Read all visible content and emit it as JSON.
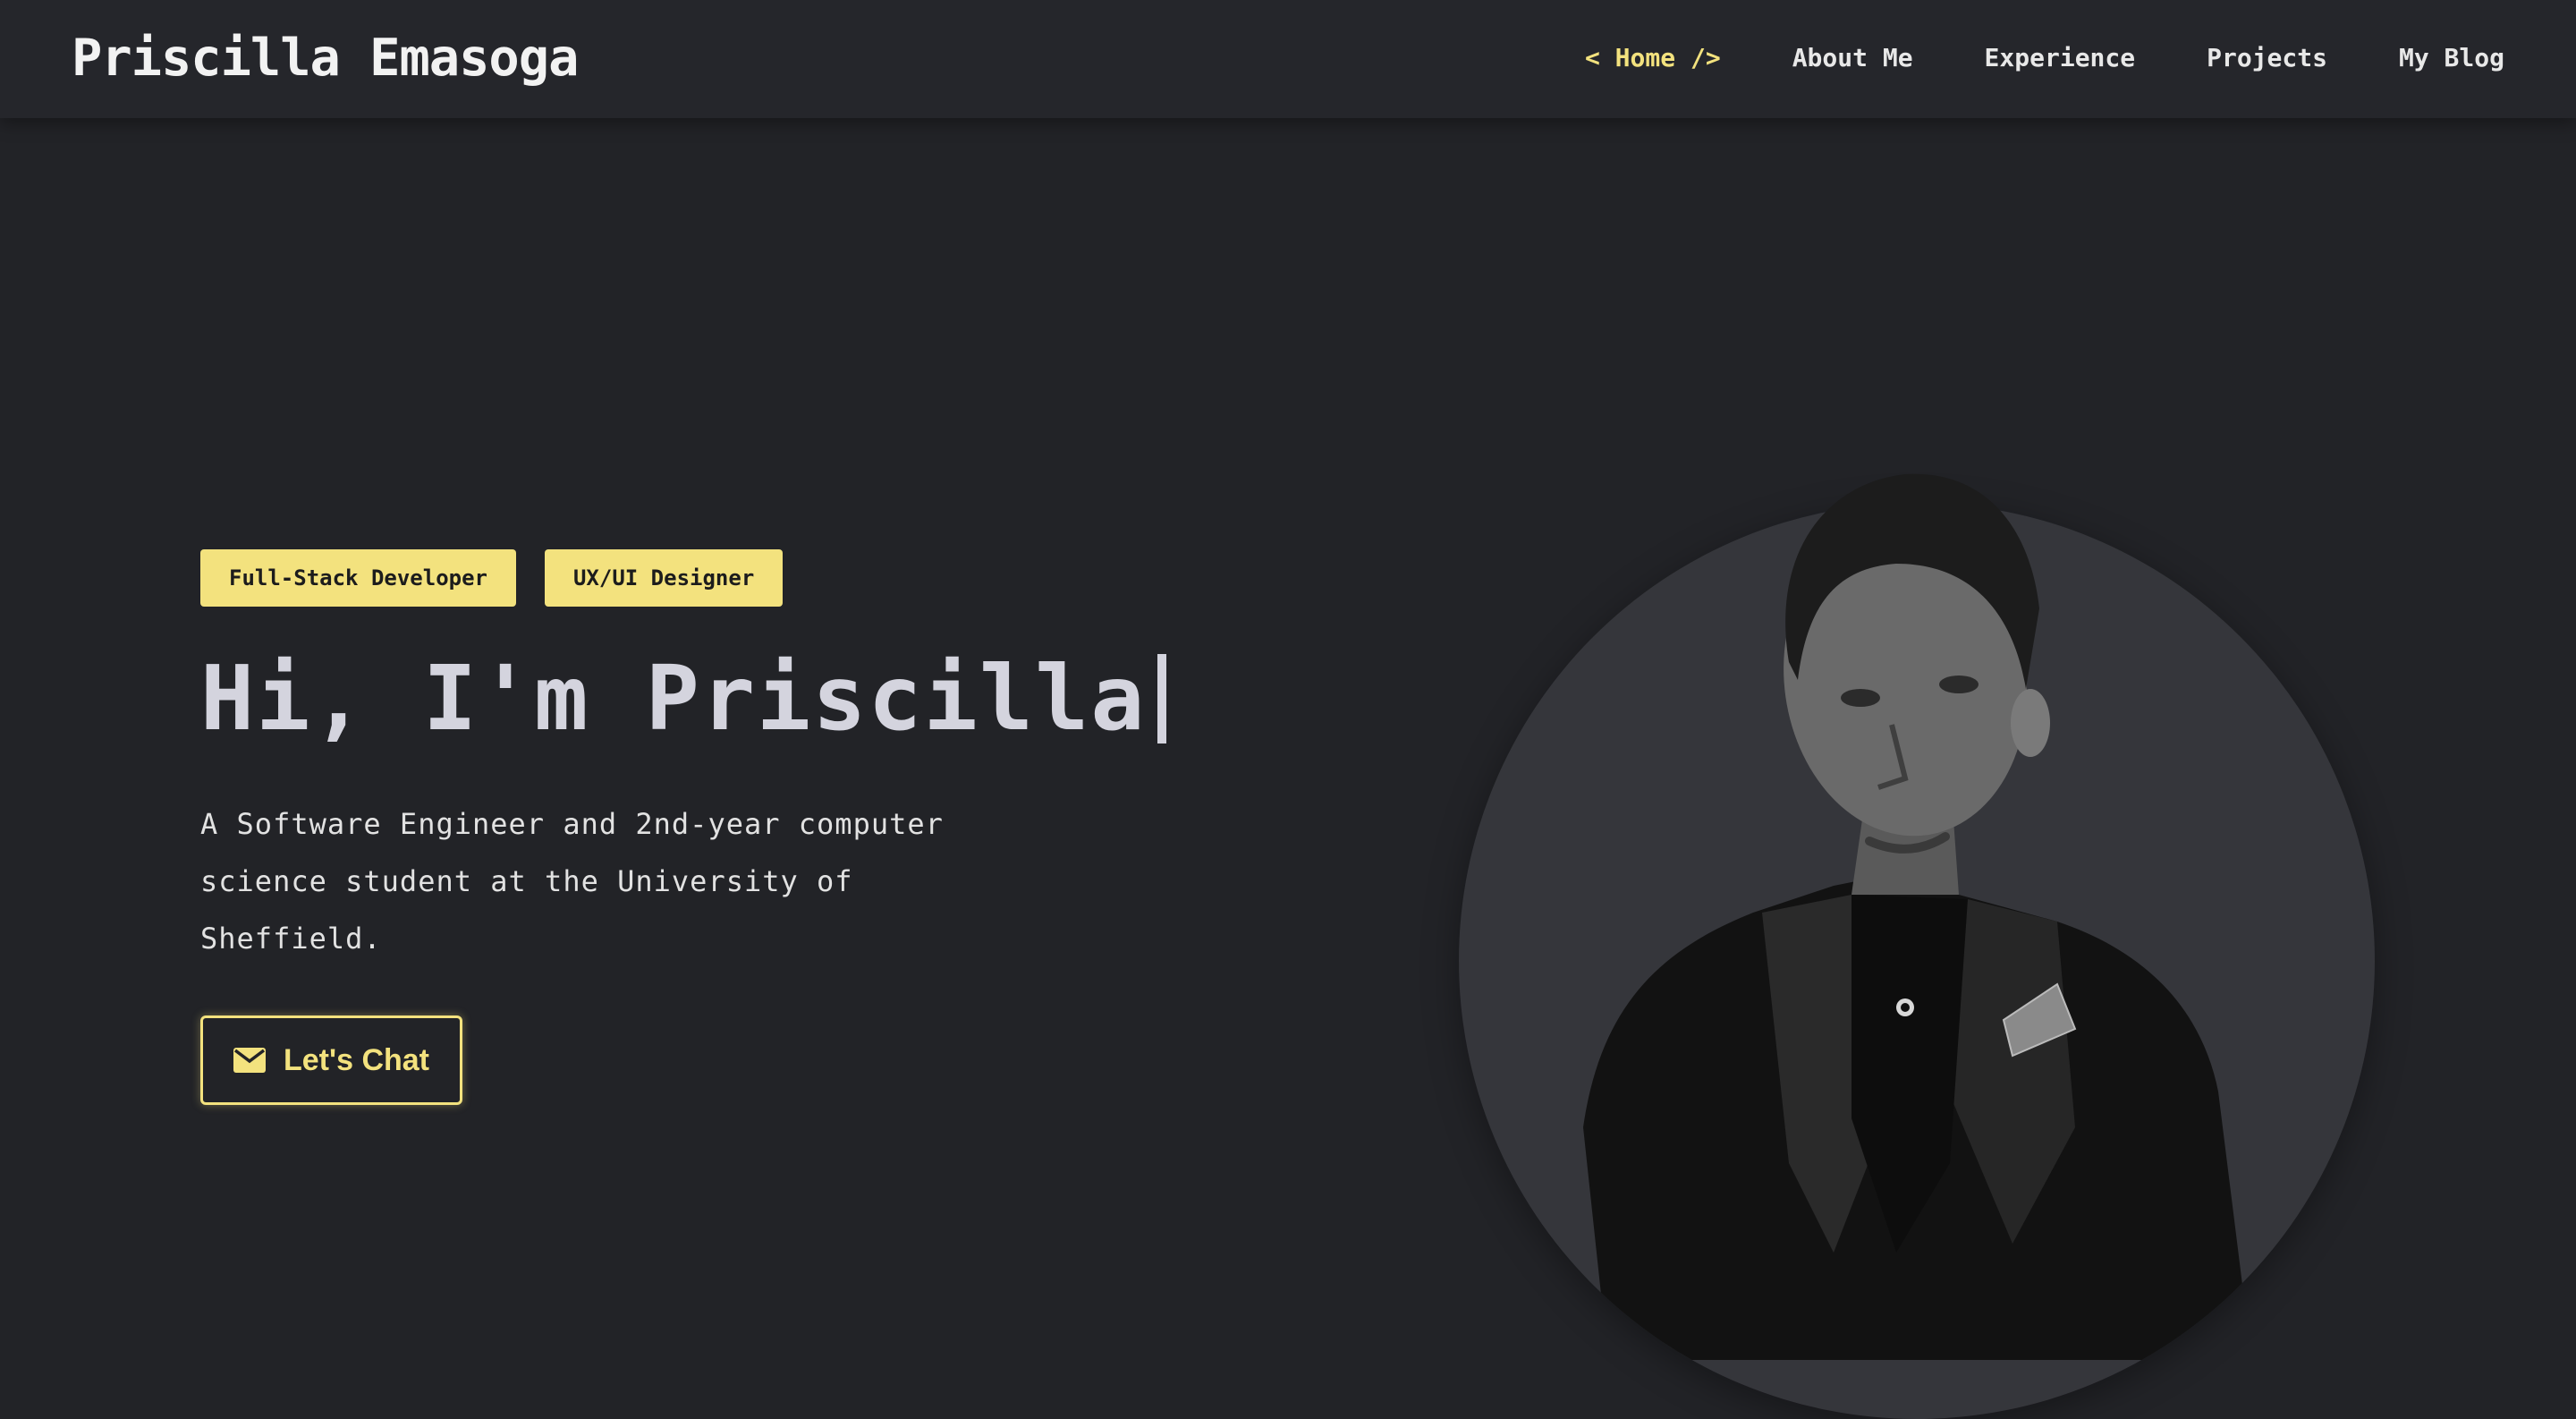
{
  "brand": "Priscilla Emasoga",
  "nav": {
    "home": "< Home />",
    "about": "About Me",
    "experience": "Experience",
    "projects": "Projects",
    "blog": "My Blog"
  },
  "hero": {
    "badges": [
      "Full-Stack Developer",
      "UX/UI Designer"
    ],
    "headline": "Hi, I'm Priscilla",
    "intro": "A Software Engineer and 2nd-year computer science student at the University of Sheffield.",
    "cta_label": "Let's Chat"
  },
  "colors": {
    "background": "#222327",
    "navbar": "#25262b",
    "accent": "#f3e27e",
    "circle": "#35363b"
  },
  "icons": {
    "cta": "mail-icon"
  }
}
